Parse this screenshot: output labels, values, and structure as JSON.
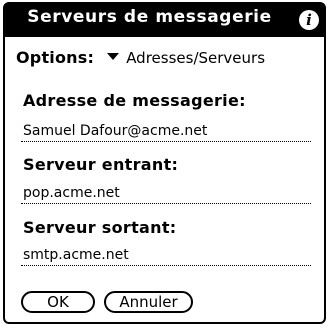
{
  "dialog": {
    "title": "Serveurs de messagerie",
    "info_icon": "info-icon"
  },
  "options": {
    "label": "Options:",
    "selected": "Adresses/Serveurs",
    "arrow_icon": "triangle-down-icon"
  },
  "fields": [
    {
      "label": "Adresse de messagerie:",
      "value": "Samuel Dafour@acme.net"
    },
    {
      "label": "Serveur entrant:",
      "value": "pop.acme.net"
    },
    {
      "label": "Serveur sortant:",
      "value": "smtp.acme.net"
    }
  ],
  "buttons": {
    "ok": "OK",
    "cancel": "Annuler"
  }
}
